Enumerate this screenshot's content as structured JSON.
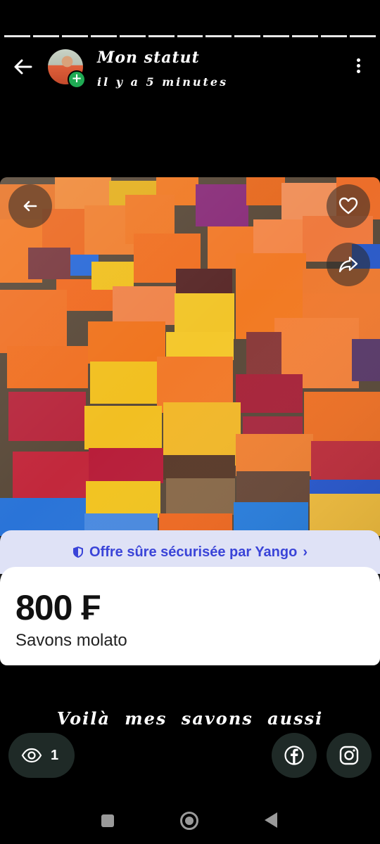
{
  "status_header": {
    "name": "Mon statut",
    "time": "il y a 5 minutes"
  },
  "progress_segments": 13,
  "listing": {
    "secure_label": "Offre sûre sécurisée par Yango",
    "secure_chevron": "›",
    "price": "800 ₣",
    "product_name": "Savons molato"
  },
  "caption": "Voilà mes savons aussi",
  "views": {
    "count": "1"
  },
  "icons": {
    "back": "arrow-left-icon",
    "menu": "more-vertical-icon",
    "heart": "heart-icon",
    "share": "share-arrow-icon",
    "eye": "eye-icon",
    "facebook": "facebook-icon",
    "instagram": "instagram-icon"
  },
  "colors": {
    "secure_text": "#3a44d8",
    "secure_bg": "#dfe2f6",
    "button_bg": "#1f2a27",
    "avatar_badge": "#1faa53"
  }
}
